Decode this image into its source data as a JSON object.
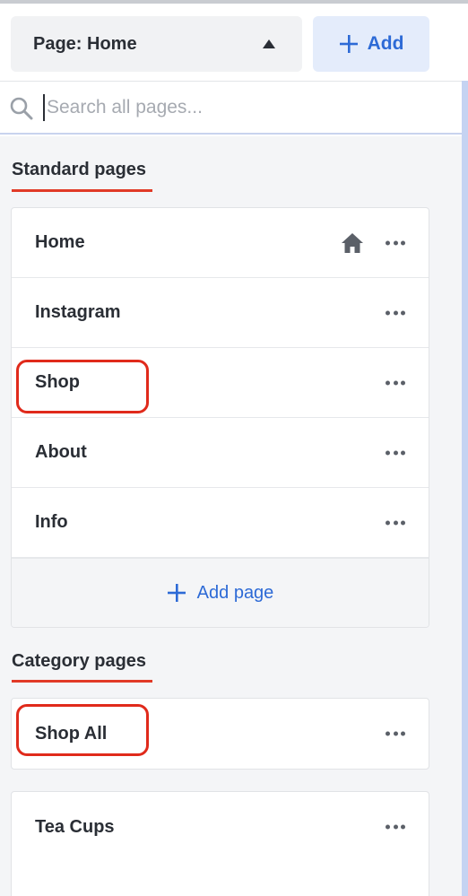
{
  "header": {
    "page_selector_label": "Page: Home",
    "add_label": "Add"
  },
  "search": {
    "placeholder": "Search all pages..."
  },
  "standard_pages": {
    "title": "Standard pages",
    "items": [
      {
        "label": "Home",
        "is_homepage": true
      },
      {
        "label": "Instagram"
      },
      {
        "label": "Shop"
      },
      {
        "label": "About"
      },
      {
        "label": "Info"
      }
    ],
    "add_page_label": "Add page"
  },
  "category_pages": {
    "title": "Category pages",
    "items": [
      {
        "label": "Shop All"
      },
      {
        "label": "Tea Cups"
      }
    ]
  },
  "colors": {
    "accent_blue": "#2d6ad6",
    "annotation_red": "#e02a1b",
    "section_underline": "#e13a27"
  }
}
